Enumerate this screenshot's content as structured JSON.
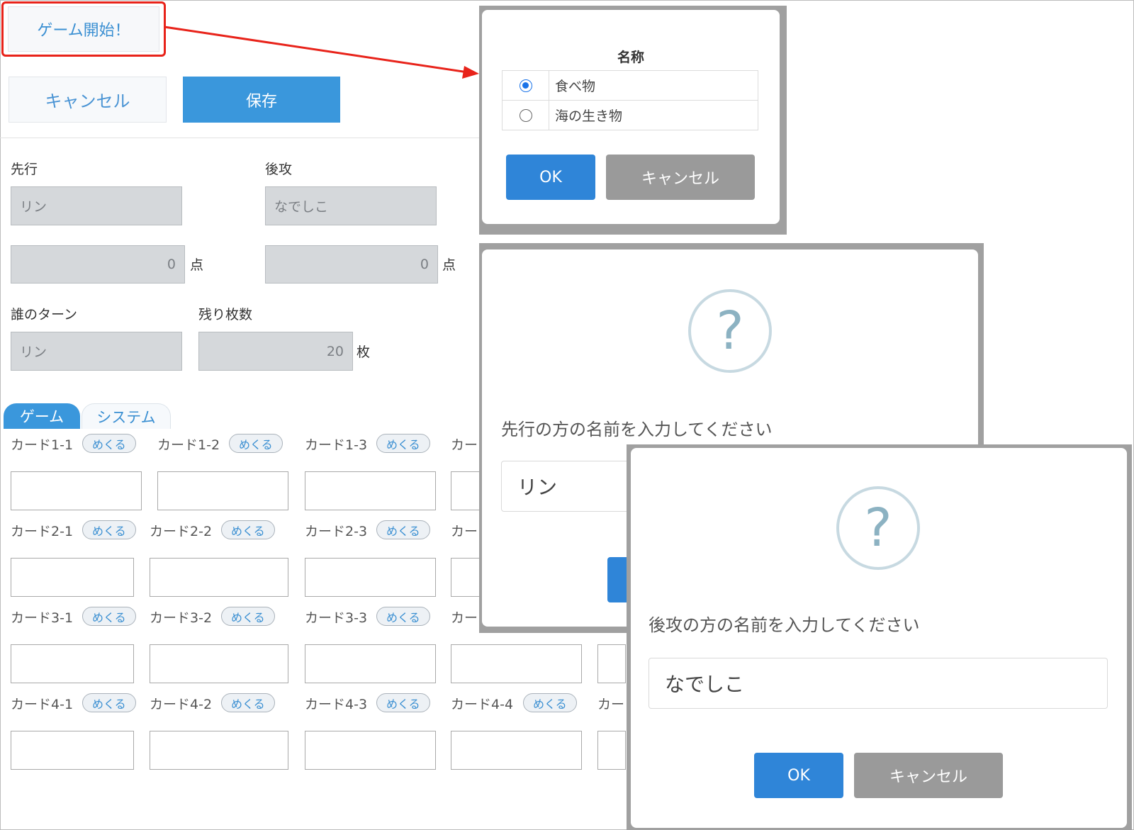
{
  "top": {
    "start_label": "ゲーム開始！"
  },
  "actions": {
    "cancel_label": "キャンセル",
    "save_label": "保存"
  },
  "form": {
    "first_label": "先行",
    "first_name": "リン",
    "second_label": "後攻",
    "second_name": "なでしこ",
    "first_score": "0",
    "second_score": "0",
    "score_unit": "点",
    "turn_label": "誰のターン",
    "turn_value": "リン",
    "remaining_label": "残り枚数",
    "remaining_value": "20",
    "remaining_unit": "枚"
  },
  "tabs": [
    {
      "label": "ゲーム",
      "active": true
    },
    {
      "label": "システム",
      "active": false
    }
  ],
  "cards": {
    "flip_label": "めくる",
    "rows": [
      [
        "カード1-1",
        "カード1-2",
        "カード1-3",
        "カー"
      ],
      [
        "カード2-1",
        "カード2-2",
        "カード2-3",
        "カー"
      ],
      [
        "カード3-1",
        "カード3-2",
        "カード3-3",
        "カー"
      ],
      [
        "カード4-1",
        "カード4-2",
        "カード4-3",
        "カード4-4",
        "カー"
      ]
    ]
  },
  "category_dialog": {
    "title": "名称",
    "options": [
      {
        "label": "食べ物",
        "selected": true
      },
      {
        "label": "海の生き物",
        "selected": false
      }
    ],
    "ok_label": "OK",
    "cancel_label": "キャンセル"
  },
  "first_dialog": {
    "icon": "question-icon",
    "icon_glyph": "?",
    "prompt": "先行の方の名前を入力してください",
    "value": "リン"
  },
  "second_dialog": {
    "icon": "question-icon",
    "icon_glyph": "?",
    "prompt": "後攻の方の名前を入力してください",
    "value": "なでしこ",
    "ok_label": "OK",
    "cancel_label": "キャンセル"
  },
  "colors": {
    "accent": "#3a97dc",
    "highlight": "#e8231a",
    "dialog_ok": "#2f85d8",
    "dialog_cancel": "#9a9a9a"
  }
}
